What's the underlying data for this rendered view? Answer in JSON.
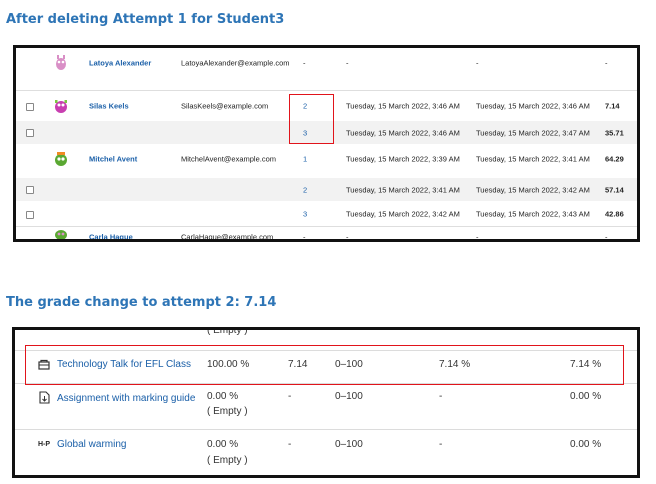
{
  "section1": {
    "heading": "After deleting Attempt 1 for Student3",
    "rows": [
      {
        "name": "Latoya Alexander",
        "email": "LatoyaAlexander@example.com",
        "attempt": "-",
        "started": "-",
        "finished": "-",
        "grade": "-"
      },
      {
        "name": "Silas Keels",
        "email": "SilasKeels@example.com",
        "attempt": "2",
        "started": "Tuesday, 15 March 2022, 3:46 AM",
        "finished": "Tuesday, 15 March 2022, 3:46 AM",
        "grade": "7.14"
      },
      {
        "name": "",
        "email": "",
        "attempt": "3",
        "started": "Tuesday, 15 March 2022, 3:46 AM",
        "finished": "Tuesday, 15 March 2022, 3:47 AM",
        "grade": "35.71"
      },
      {
        "name": "Mitchel Avent",
        "email": "MitchelAvent@example.com",
        "attempt": "1",
        "started": "Tuesday, 15 March 2022, 3:39 AM",
        "finished": "Tuesday, 15 March 2022, 3:41 AM",
        "grade": "64.29"
      },
      {
        "name": "",
        "email": "",
        "attempt": "2",
        "started": "Tuesday, 15 March 2022, 3:41 AM",
        "finished": "Tuesday, 15 March 2022, 3:42 AM",
        "grade": "57.14"
      },
      {
        "name": "",
        "email": "",
        "attempt": "3",
        "started": "Tuesday, 15 March 2022, 3:42 AM",
        "finished": "Tuesday, 15 March 2022, 3:43 AM",
        "grade": "42.86"
      },
      {
        "name": "Carla Hague",
        "email": "CarlaHague@example.com",
        "attempt": "-",
        "started": "-",
        "finished": "-",
        "grade": "-"
      }
    ]
  },
  "section2": {
    "heading": "The grade change to attempt 2: 7.14",
    "top_partial": "( Empty )",
    "rows": [
      {
        "icon": "quiz-icon",
        "item": "Technology Talk for EFL Class",
        "weight": "100.00 %",
        "weight_sub": "",
        "grade": "7.14",
        "range": "0–100",
        "percentage": "7.14 %",
        "contribution": "7.14 %"
      },
      {
        "icon": "assignment-icon",
        "item": "Assignment with marking guide",
        "weight": "0.00 %",
        "weight_sub": "( Empty )",
        "grade": "-",
        "range": "0–100",
        "percentage": "-",
        "contribution": "0.00 %"
      },
      {
        "icon": "h5p-icon",
        "item": "Global warming",
        "weight": "0.00 %",
        "weight_sub": "( Empty )",
        "grade": "-",
        "range": "0–100",
        "percentage": "-",
        "contribution": "0.00 %"
      }
    ],
    "h5p_icon_text": "H-P"
  },
  "colors": {
    "heading": "#2e75b6",
    "link": "#1a5fa8",
    "highlight": "#e1141b",
    "frame": "#111111"
  }
}
